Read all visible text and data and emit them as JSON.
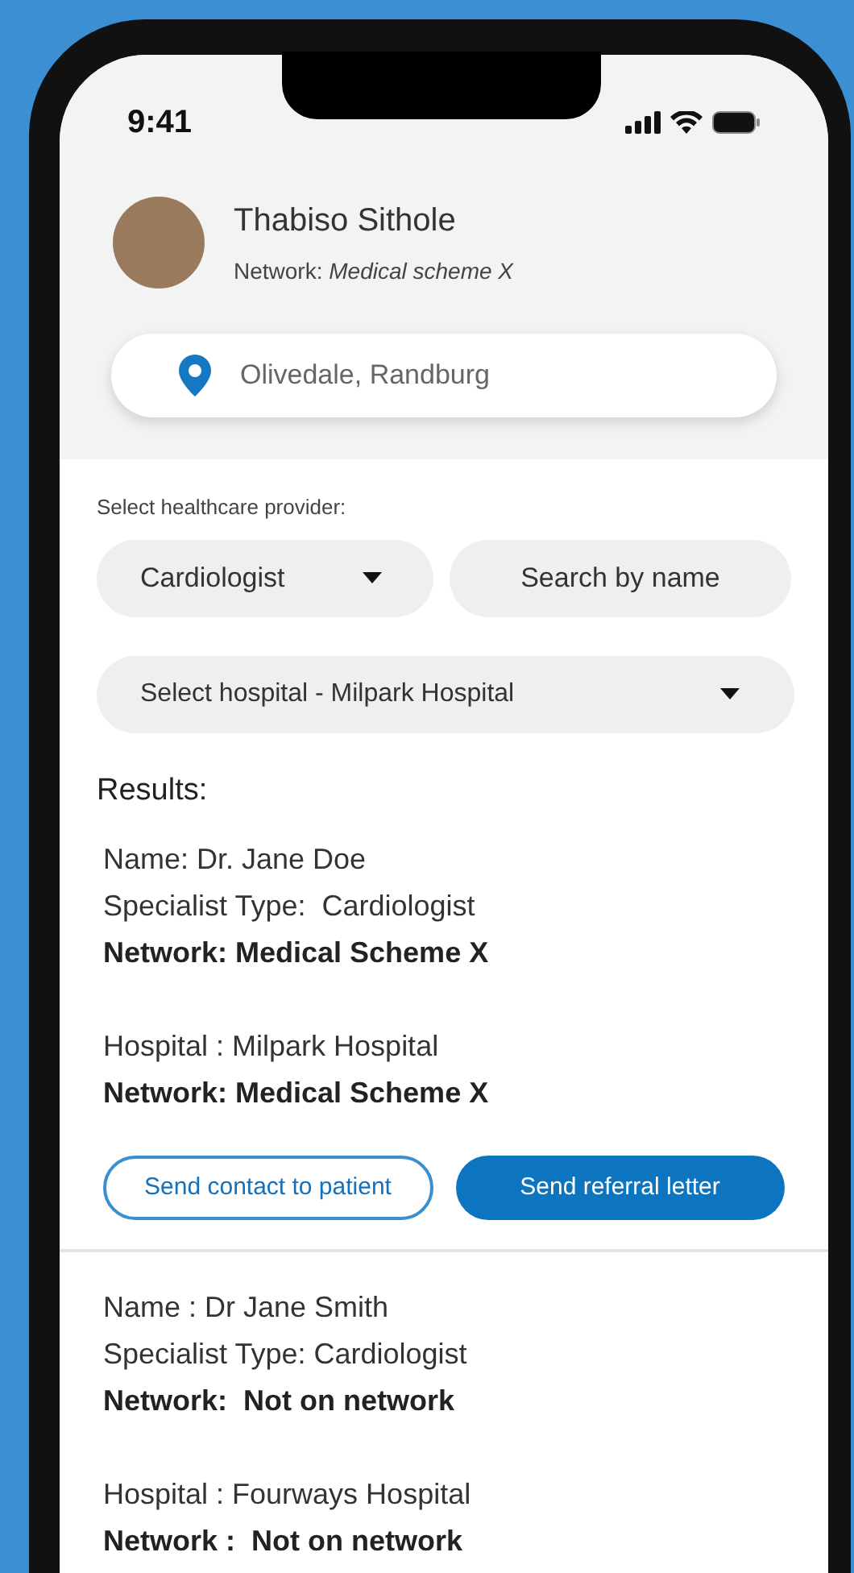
{
  "status_bar": {
    "time": "9:41"
  },
  "profile": {
    "name": "Thabiso Sithole",
    "network": "Network: *Medical scheme X*"
  },
  "location": {
    "value": "Olivedale, Randburg"
  },
  "filters": {
    "label": "Select healthcare provider:",
    "specialist": "Cardiologist",
    "search": {
      "placeholder": "Search by name"
    },
    "hospital": "Select hospital - Milpark Hospital"
  },
  "results": {
    "title": "Results:",
    "items": [
      {
        "lines": [
          {
            "kind": "plain",
            "text": "Name: Dr. Jane Doe"
          },
          {
            "kind": "plain",
            "text": "Specialist Type:  Cardiologist"
          },
          {
            "kind": "bold",
            "text": "Network: Medical Scheme X"
          },
          {
            "kind": "gap"
          },
          {
            "kind": "plain",
            "text": "Hospital : Milpark Hospital"
          },
          {
            "kind": "bold",
            "text": "Network: Medical Scheme X"
          }
        ],
        "buttons": [
          {
            "kind": "outline",
            "label": "Send contact to patient"
          },
          {
            "kind": "filled",
            "label": "Send referral letter"
          }
        ]
      },
      {
        "lines": [
          {
            "kind": "plain",
            "text": "Name : Dr Jane Smith"
          },
          {
            "kind": "plain",
            "text": "Specialist Type: Cardiologist"
          },
          {
            "kind": "bold",
            "text": "Network:  Not on network"
          },
          {
            "kind": "gap"
          },
          {
            "kind": "plain",
            "text": "Hospital : Fourways Hospital"
          },
          {
            "kind": "bold",
            "text": "Network :  Not on network"
          }
        ]
      }
    ]
  }
}
